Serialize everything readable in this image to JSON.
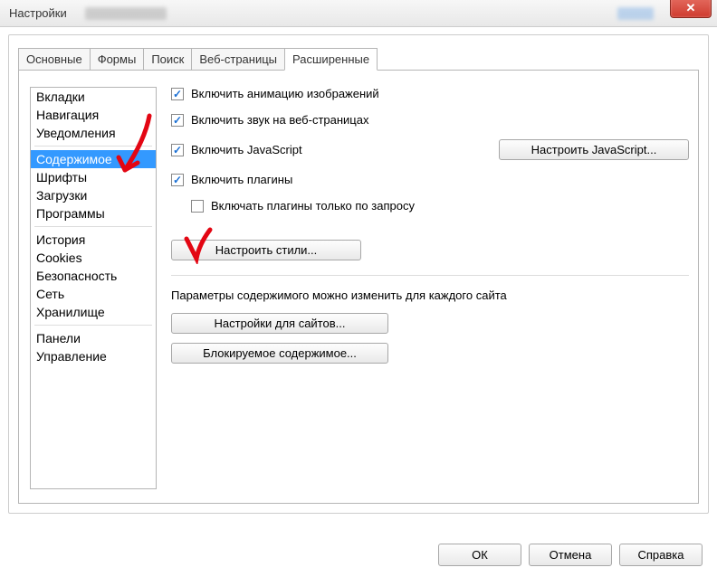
{
  "window": {
    "title": "Настройки",
    "close_glyph": "✕"
  },
  "tabs": [
    {
      "label": "Основные",
      "active": false
    },
    {
      "label": "Формы",
      "active": false
    },
    {
      "label": "Поиск",
      "active": false
    },
    {
      "label": "Веб-страницы",
      "active": false
    },
    {
      "label": "Расширенные",
      "active": true
    }
  ],
  "sidebar": {
    "groups": [
      [
        "Вкладки",
        "Навигация",
        "Уведомления"
      ],
      [
        "Содержимое",
        "Шрифты",
        "Загрузки",
        "Программы"
      ],
      [
        "История",
        "Cookies",
        "Безопасность",
        "Сеть",
        "Хранилище"
      ],
      [
        "Панели",
        "Управление"
      ]
    ],
    "selected": "Содержимое"
  },
  "content": {
    "checkboxes": {
      "anim_images": {
        "label": "Включить анимацию изображений",
        "checked": true
      },
      "sound": {
        "label": "Включить звук на веб-страницах",
        "checked": true
      },
      "javascript": {
        "label": "Включить JavaScript",
        "checked": true
      },
      "plugins": {
        "label": "Включить плагины",
        "checked": true
      },
      "plugins_on_demand": {
        "label": "Включать плагины только по запросу",
        "checked": false
      }
    },
    "buttons": {
      "config_js": "Настроить JavaScript...",
      "config_styles": "Настроить стили...",
      "site_settings": "Настройки для сайтов...",
      "blocked_content": "Блокируемое содержимое..."
    },
    "site_hint": "Параметры содержимого можно изменить для каждого сайта"
  },
  "footer": {
    "ok": "ОК",
    "cancel": "Отмена",
    "help": "Справка"
  }
}
